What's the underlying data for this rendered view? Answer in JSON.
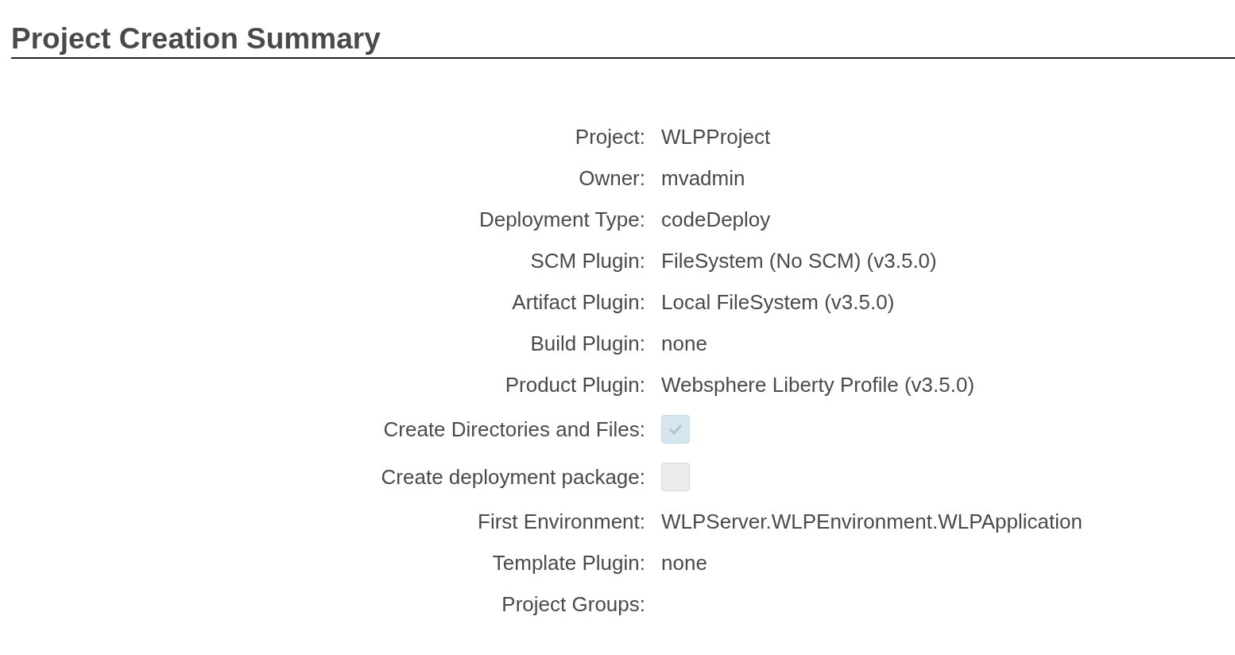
{
  "title": "Project Creation Summary",
  "rows": [
    {
      "kind": "text",
      "label": "Project:",
      "value": "WLPProject"
    },
    {
      "kind": "text",
      "label": "Owner:",
      "value": "mvadmin"
    },
    {
      "kind": "text",
      "label": "Deployment Type:",
      "value": "codeDeploy"
    },
    {
      "kind": "text",
      "label": "SCM Plugin:",
      "value": "FileSystem (No SCM) (v3.5.0)"
    },
    {
      "kind": "text",
      "label": "Artifact Plugin:",
      "value": "Local FileSystem (v3.5.0)"
    },
    {
      "kind": "text",
      "label": "Build Plugin:",
      "value": "none"
    },
    {
      "kind": "text",
      "label": "Product Plugin:",
      "value": "Websphere Liberty Profile (v3.5.0)"
    },
    {
      "kind": "checkbox",
      "label": "Create Directories and Files:",
      "checked": true
    },
    {
      "kind": "checkbox",
      "label": "Create deployment package:",
      "checked": false
    },
    {
      "kind": "text",
      "label": "First Environment:",
      "value": "WLPServer.WLPEnvironment.WLPApplication"
    },
    {
      "kind": "text",
      "label": "Template Plugin:",
      "value": "none"
    },
    {
      "kind": "text",
      "label": "Project Groups:"
    }
  ]
}
